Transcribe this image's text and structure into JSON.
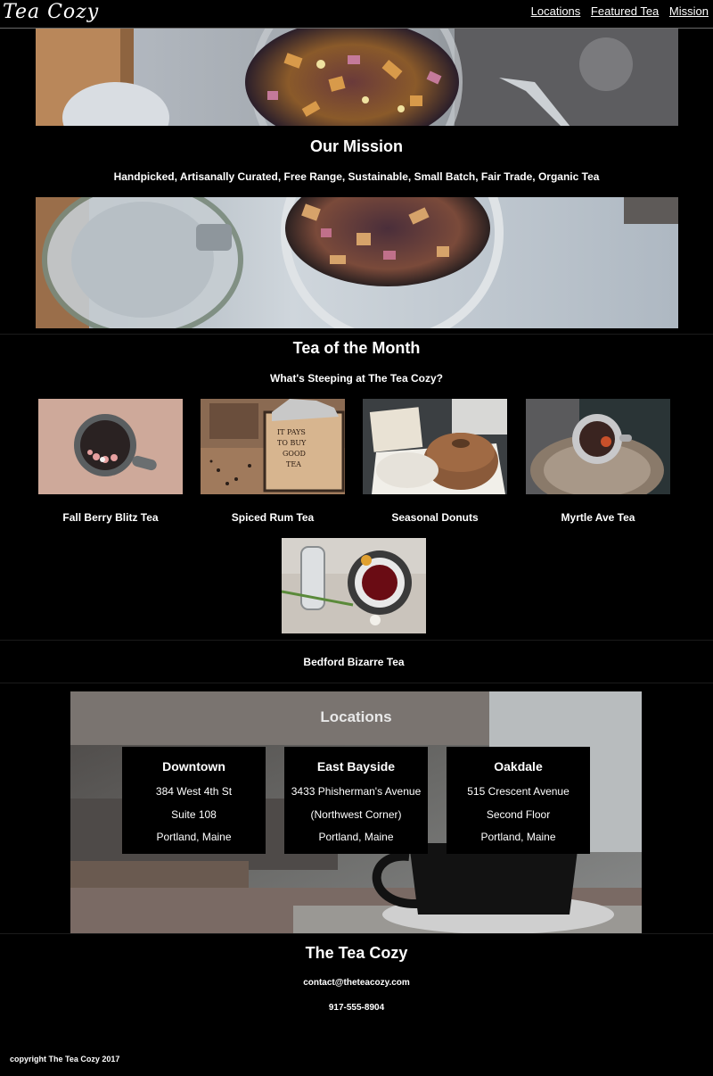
{
  "header": {
    "logo": "Tea Cozy",
    "nav": [
      "Locations",
      "Featured Tea",
      "Mission"
    ]
  },
  "mission": {
    "title": "Our Mission",
    "subtitle": "Handpicked, Artisanally Curated, Free Range, Sustainable, Small Batch, Fair Trade, Organic Tea"
  },
  "tea_of_month": {
    "title": "Tea of the Month",
    "subtitle": "What's Steeping at The Tea Cozy?",
    "items": [
      {
        "label": "Fall Berry Blitz Tea"
      },
      {
        "label": "Spiced Rum Tea"
      },
      {
        "label": "Seasonal Donuts"
      },
      {
        "label": "Myrtle Ave Tea"
      },
      {
        "label": "Bedford Bizarre Tea"
      }
    ],
    "box_sign": [
      "IT PAYS",
      "TO BUY",
      "GOOD",
      "TEA"
    ]
  },
  "locations": {
    "title": "Locations",
    "stores": [
      {
        "name": "Downtown",
        "lines": [
          "384 West 4th St",
          "Suite 108",
          "Portland, Maine"
        ]
      },
      {
        "name": "East Bayside",
        "lines": [
          "3433 Phisherman's Avenue",
          "(Northwest Corner)",
          "Portland, Maine"
        ]
      },
      {
        "name": "Oakdale",
        "lines": [
          "515 Crescent Avenue",
          "Second Floor",
          "Portland, Maine"
        ]
      }
    ]
  },
  "footer": {
    "title": "The Tea Cozy",
    "email": "contact@theteacozy.com",
    "phone": "917-555-8904",
    "copyright": "copyright The Tea Cozy 2017"
  }
}
